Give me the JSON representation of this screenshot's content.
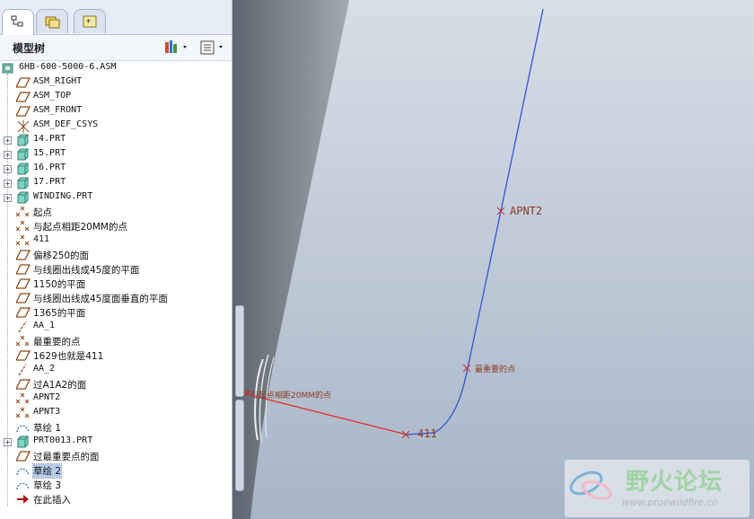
{
  "panel": {
    "title": "模型树",
    "tabs": [
      "model-tree-tab",
      "folder-browser-tab",
      "favorites-tab"
    ]
  },
  "tree": {
    "items": [
      {
        "label": "6HB-600-5000-6.ASM",
        "icon": "assembly-icon",
        "level": 0,
        "expandable": false
      },
      {
        "label": "ASM_RIGHT",
        "icon": "datum-plane-icon",
        "level": 1,
        "expandable": false
      },
      {
        "label": "ASM_TOP",
        "icon": "datum-plane-icon",
        "level": 1,
        "expandable": false
      },
      {
        "label": "ASM_FRONT",
        "icon": "datum-plane-icon",
        "level": 1,
        "expandable": false
      },
      {
        "label": "ASM_DEF_CSYS",
        "icon": "csys-icon",
        "level": 1,
        "expandable": false
      },
      {
        "label": "14.PRT",
        "icon": "part-icon",
        "level": 1,
        "expandable": true
      },
      {
        "label": "15.PRT",
        "icon": "part-icon",
        "level": 1,
        "expandable": true
      },
      {
        "label": "16.PRT",
        "icon": "part-icon",
        "level": 1,
        "expandable": true
      },
      {
        "label": "17.PRT",
        "icon": "part-icon",
        "level": 1,
        "expandable": true
      },
      {
        "label": "WINDING.PRT",
        "icon": "part-icon",
        "level": 1,
        "expandable": true
      },
      {
        "label": "起点",
        "icon": "datum-point-icon",
        "level": 1,
        "expandable": false
      },
      {
        "label": "与起点相距20MM的点",
        "icon": "datum-point-icon",
        "level": 1,
        "expandable": false
      },
      {
        "label": "411",
        "icon": "datum-point-icon",
        "level": 1,
        "expandable": false
      },
      {
        "label": "偏移250的面",
        "icon": "datum-plane-icon",
        "level": 1,
        "expandable": false
      },
      {
        "label": "与线圈出线成45度的平面",
        "icon": "datum-plane-icon",
        "level": 1,
        "expandable": false
      },
      {
        "label": "1150的平面",
        "icon": "datum-plane-icon",
        "level": 1,
        "expandable": false
      },
      {
        "label": "与线圈出线成45度面垂直的平面",
        "icon": "datum-plane-icon",
        "level": 1,
        "expandable": false
      },
      {
        "label": "1365的平面",
        "icon": "datum-plane-icon",
        "level": 1,
        "expandable": false
      },
      {
        "label": "AA_1",
        "icon": "datum-axis-icon",
        "level": 1,
        "expandable": false
      },
      {
        "label": "最重要的点",
        "icon": "datum-point-icon",
        "level": 1,
        "expandable": false
      },
      {
        "label": "1629也就是411",
        "icon": "datum-plane-icon",
        "level": 1,
        "expandable": false
      },
      {
        "label": "AA_2",
        "icon": "datum-axis-icon",
        "level": 1,
        "expandable": false
      },
      {
        "label": "过A1A2的面",
        "icon": "datum-plane-icon",
        "level": 1,
        "expandable": false
      },
      {
        "label": "APNT2",
        "icon": "datum-point-icon",
        "level": 1,
        "expandable": false
      },
      {
        "label": "APNT3",
        "icon": "datum-point-icon",
        "level": 1,
        "expandable": false
      },
      {
        "label": "草绘 1",
        "icon": "sketch-icon",
        "level": 1,
        "expandable": false
      },
      {
        "label": "PRT0013.PRT",
        "icon": "part-icon",
        "level": 1,
        "expandable": true
      },
      {
        "label": "过最重要点的面",
        "icon": "datum-plane-icon",
        "level": 1,
        "expandable": false
      },
      {
        "label": "草绘 2",
        "icon": "sketch-icon",
        "level": 1,
        "expandable": false,
        "selected": true
      },
      {
        "label": "草绘 3",
        "icon": "sketch-icon",
        "level": 1,
        "expandable": false
      },
      {
        "label": "在此插入",
        "icon": "insert-here-arrow-icon",
        "level": 1,
        "expandable": false
      }
    ]
  },
  "viewport": {
    "labels": {
      "apnt2": "APNT2",
      "important_point": "最重要的点",
      "pt411": "411",
      "pt20mm": "与起点相距20MM的点"
    },
    "colors": {
      "background": "#c3ceda",
      "curve_blue": "#3353d6",
      "curve_red": "#e0302c",
      "label": "#8a3a22"
    }
  },
  "watermark": {
    "title": "野火论坛",
    "url": "www.proewildfire.cn"
  }
}
